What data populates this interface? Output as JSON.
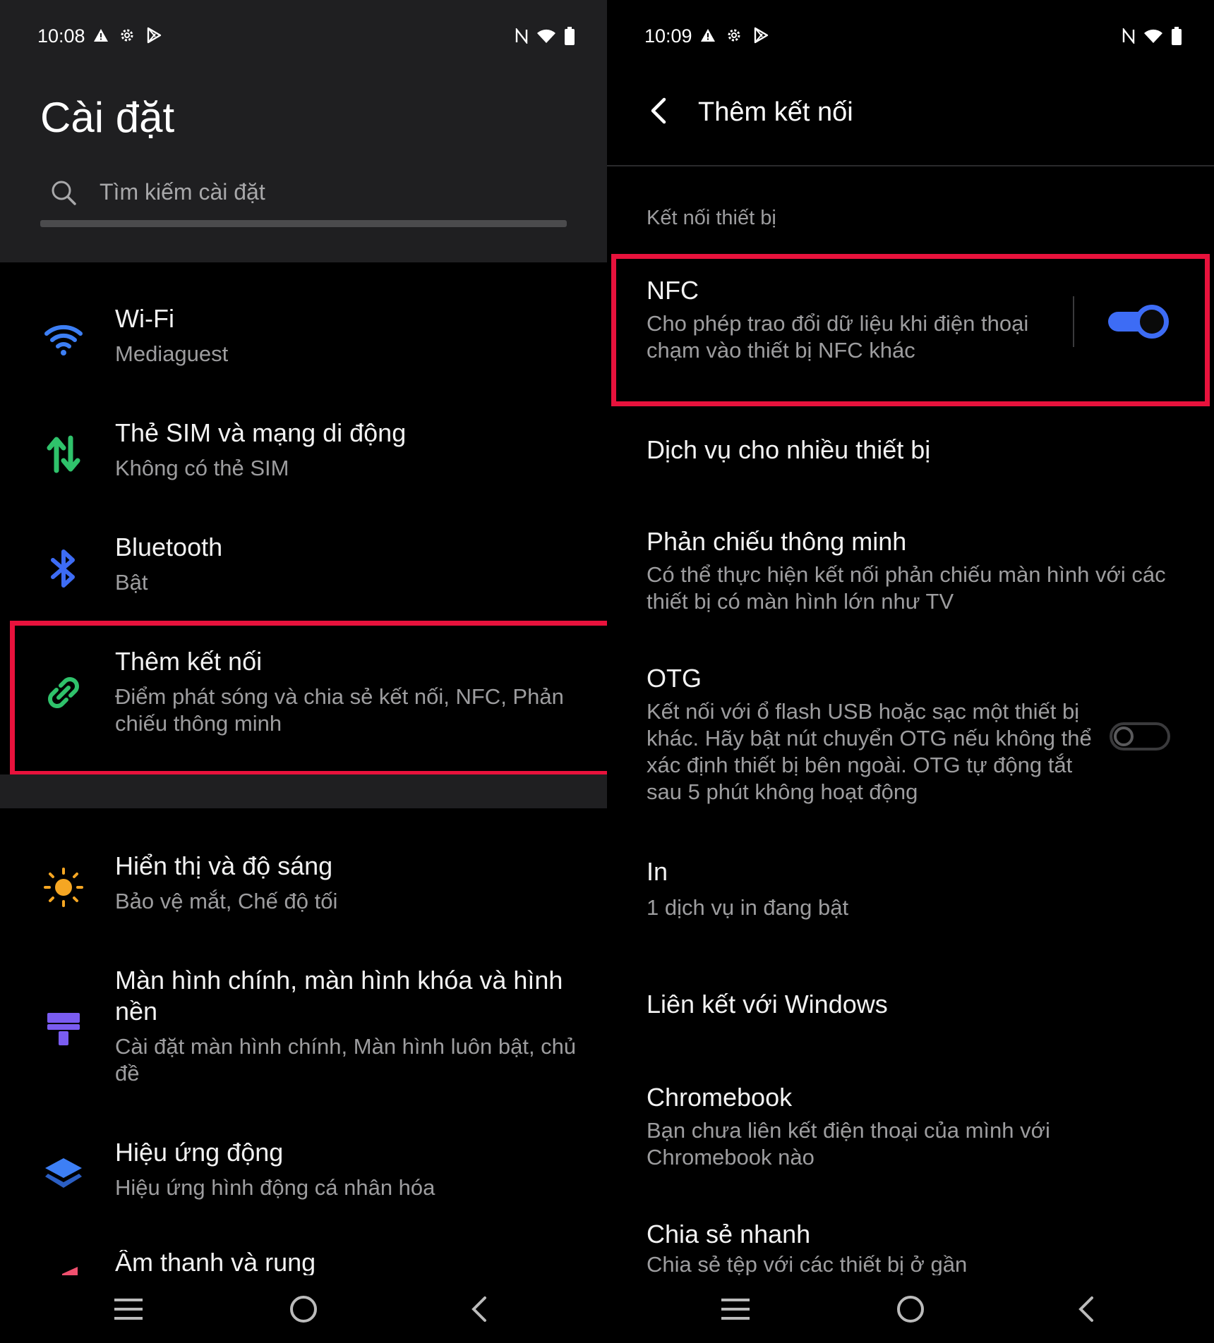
{
  "left": {
    "status": {
      "time": "10:08"
    },
    "title": "Cài đặt",
    "search": {
      "placeholder": "Tìm kiếm cài đặt"
    },
    "items": [
      {
        "title": "Wi-Fi",
        "subtitle": "Mediaguest",
        "icon": "wifi-icon",
        "color": "#3d7ff5"
      },
      {
        "title": "Thẻ SIM và mạng di động",
        "subtitle": "Không có thẻ SIM",
        "icon": "data-arrows-icon",
        "color": "#2fc26b"
      },
      {
        "title": "Bluetooth",
        "subtitle": "Bật",
        "icon": "bluetooth-icon",
        "color": "#3d6cf5"
      },
      {
        "title": "Thêm kết nối",
        "subtitle": "Điểm phát sóng và chia sẻ kết nối, NFC, Phản chiếu thông minh",
        "icon": "link-icon",
        "color": "#2fc26b"
      },
      {
        "title": "Hiển thị và độ sáng",
        "subtitle": "Bảo vệ mắt, Chế độ tối",
        "icon": "sun-icon",
        "color": "#f5a623"
      },
      {
        "title": "Màn hình chính, màn hình khóa và hình nền",
        "subtitle": "Cài đặt màn hình chính, Màn hình luôn bật, chủ đề",
        "icon": "paint-roller-icon",
        "color": "#7a5cf0"
      },
      {
        "title": "Hiệu ứng động",
        "subtitle": "Hiệu ứng hình động cá nhân hóa",
        "icon": "layers-icon",
        "color": "#3d7ff5"
      },
      {
        "title": "Âm thanh và rung",
        "subtitle": "",
        "icon": "volume-icon",
        "color": "#f0506e"
      }
    ]
  },
  "right": {
    "status": {
      "time": "10:09"
    },
    "title": "Thêm kết nối",
    "section": "Kết nối thiết bị",
    "items": [
      {
        "title": "NFC",
        "subtitle": "Cho phép trao đổi dữ liệu khi điện thoại chạm vào thiết bị NFC khác",
        "toggle": "on"
      },
      {
        "title": "Dịch vụ cho nhiều thiết bị",
        "subtitle": ""
      },
      {
        "title": "Phản chiếu thông minh",
        "subtitle": "Có thể thực hiện kết nối phản chiếu màn hình với các thiết bị có màn hình lớn như TV"
      },
      {
        "title": "OTG",
        "subtitle": "Kết nối với ổ flash USB hoặc sạc một thiết bị khác. Hãy bật nút chuyển OTG nếu không thể xác định thiết bị bên ngoài. OTG tự động tắt sau 5 phút không hoạt động",
        "toggle": "off"
      },
      {
        "title": "In",
        "subtitle": "1 dịch vụ in đang bật"
      },
      {
        "title": "Liên kết với Windows",
        "subtitle": ""
      },
      {
        "title": "Chromebook",
        "subtitle": "Bạn chưa liên kết điện thoại của mình với Chromebook nào"
      },
      {
        "title": "Chia sẻ nhanh",
        "subtitle": "Chia sẻ tệp với các thiết bị ở gần"
      }
    ]
  },
  "colors": {
    "highlight": "#e8123c",
    "accent": "#3d6cf5",
    "background": "#000000",
    "header": "#1f1f21"
  }
}
